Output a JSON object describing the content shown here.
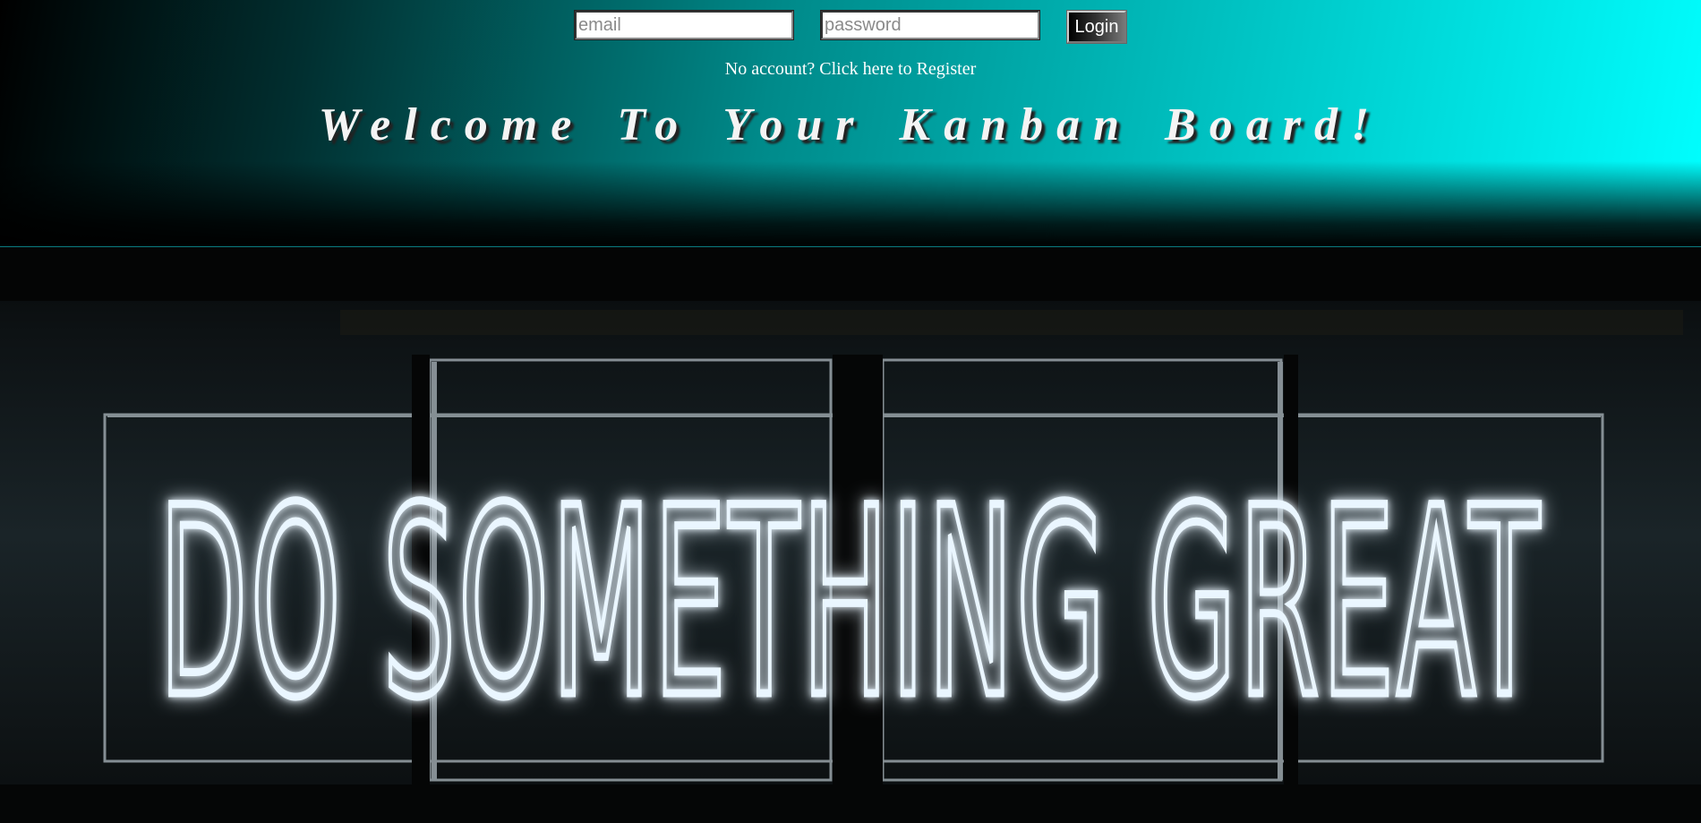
{
  "login": {
    "email_placeholder": "email",
    "password_placeholder": "password",
    "login_label": "Login"
  },
  "register_text": "No account? Click here to Register",
  "welcome_title": "Welcome To Your Kanban Board!",
  "hero": {
    "sign_text": "DO SOMETHING GREAT",
    "image_alt": "neon sign"
  },
  "colors": {
    "accent": "#00ffff",
    "header_dark": "#000000",
    "neon": "#eaf6ff"
  }
}
